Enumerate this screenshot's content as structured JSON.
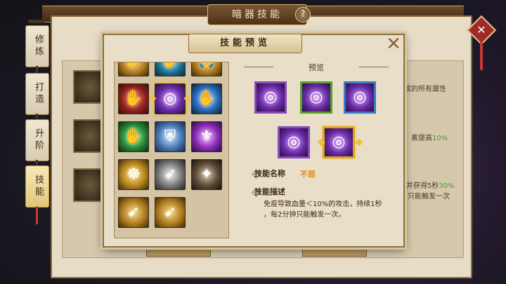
{
  "window": {
    "title": "暗器技能",
    "help": "?"
  },
  "side_tabs": [
    {
      "label": "修炼",
      "active": false
    },
    {
      "label": "打造",
      "active": false
    },
    {
      "label": "升阶",
      "active": false
    },
    {
      "label": "技能",
      "active": true
    }
  ],
  "back_content": {
    "line1": "成的所有属性",
    "line2_prefix": "素提高",
    "line2_value": "10%",
    "line3_prefix": "并获得5秒",
    "line3_value": "30%",
    "line4": "只能触发一次"
  },
  "modal": {
    "title": "技能预览",
    "close": "✕",
    "preview_label": "预览",
    "skill_name_label": "技能名称",
    "skill_name_value": "不屈",
    "skill_desc_label": "技能描述",
    "skill_desc_line1": "免疫导致血量＜10%的攻击，持续1秒",
    "skill_desc_line2": "，每2分钟只能触发一次。"
  },
  "skill_icons": [
    {
      "name": "flame-palm-icon",
      "glyph": "✋",
      "color": "g-gold"
    },
    {
      "name": "water-palm-icon",
      "glyph": "✋",
      "color": "g-cyan"
    },
    {
      "name": "pray-palm-icon",
      "glyph": "🙏",
      "color": "g-gold"
    },
    {
      "name": "fire-hand-icon",
      "glyph": "✋",
      "color": "g-red"
    },
    {
      "name": "purple-disc-icon",
      "glyph": "◎",
      "color": "g-purple",
      "selected": true
    },
    {
      "name": "blue-hand-icon",
      "glyph": "✋",
      "color": "g-blue"
    },
    {
      "name": "green-hand-icon",
      "glyph": "✋",
      "color": "g-green"
    },
    {
      "name": "shield-icon",
      "glyph": "⛨",
      "color": "g-shield"
    },
    {
      "name": "violet-armor-icon",
      "glyph": "⚜",
      "color": "g-violet"
    },
    {
      "name": "golden-wheel-icon",
      "glyph": "☸",
      "color": "g-wheel"
    },
    {
      "name": "steel-blade-icon",
      "glyph": "➶",
      "color": "g-steel"
    },
    {
      "name": "dark-darts-icon",
      "glyph": "✦",
      "color": "g-dark"
    },
    {
      "name": "golden-darts-icon",
      "glyph": "➹",
      "color": "g-gold"
    },
    {
      "name": "golden-blades-icon",
      "glyph": "➹",
      "color": "g-gold"
    }
  ],
  "preview_icons": [
    {
      "name": "preview-purple-frame",
      "frame": "purple",
      "glyph": "◎"
    },
    {
      "name": "preview-green-frame",
      "frame": "green",
      "glyph": "◎"
    },
    {
      "name": "preview-blue-frame",
      "frame": "blue",
      "glyph": "◎"
    },
    {
      "name": "preview-violet-frame",
      "frame": "purple",
      "glyph": "◎"
    },
    {
      "name": "preview-orange-frame",
      "frame": "orange",
      "glyph": "◎",
      "selected": true
    }
  ]
}
